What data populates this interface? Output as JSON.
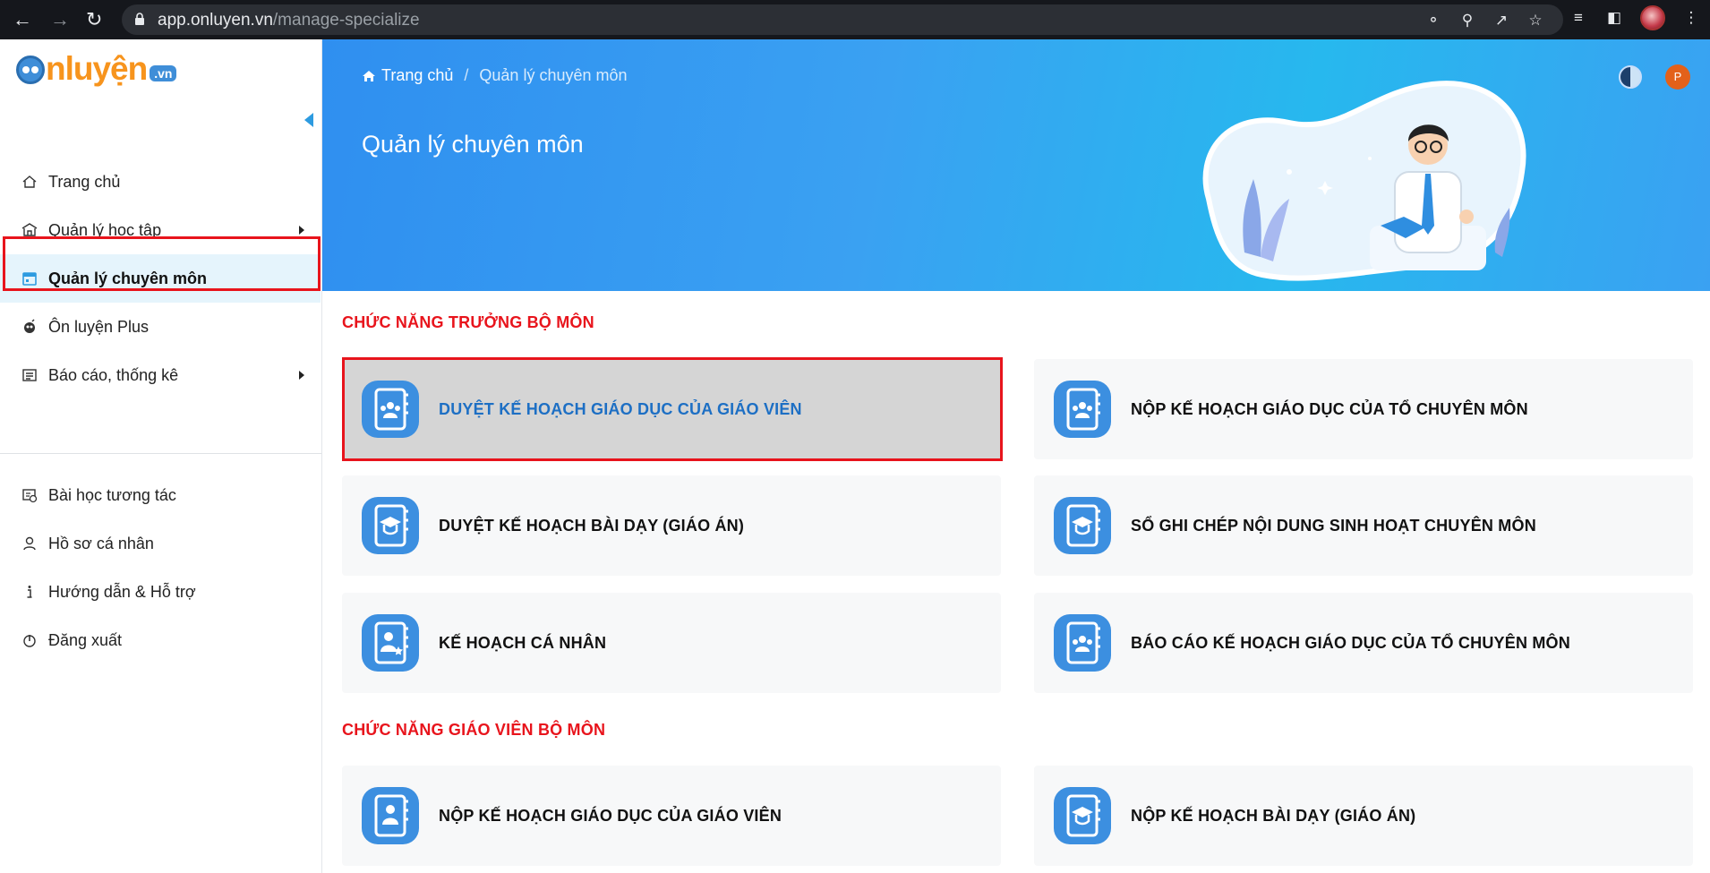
{
  "browser": {
    "url_host": "app.onluyen.vn",
    "url_path": "/manage-specialize",
    "nav_icons": [
      "back-icon",
      "forward-icon",
      "reload-icon"
    ],
    "url_icons": [
      "key-icon",
      "zoom-icon",
      "share-icon",
      "star-icon"
    ],
    "toolbar_icons": [
      "media-icon",
      "sidebar-icon",
      "profile-avatar"
    ]
  },
  "logo": {
    "text": "nluyện",
    "badge": ".vn"
  },
  "sidebar": {
    "items": [
      {
        "label": "Trang chủ",
        "icon": "home-icon"
      },
      {
        "label": "Quản lý học tập",
        "icon": "school-icon",
        "has_submenu": true
      },
      {
        "label": "Quản lý chuyên môn",
        "icon": "calendar-icon",
        "active": true
      },
      {
        "label": "Ôn luyện Plus",
        "icon": "plus-icon"
      },
      {
        "label": "Báo cáo, thống kê",
        "icon": "report-icon",
        "has_submenu": true
      }
    ],
    "items2": [
      {
        "label": "Bài học tương tác",
        "icon": "interactive-lesson-icon"
      },
      {
        "label": "Hồ sơ cá nhân",
        "icon": "user-icon"
      },
      {
        "label": "Hướng dẫn & Hỗ trợ",
        "icon": "info-icon"
      },
      {
        "label": "Đăng xuất",
        "icon": "power-icon"
      }
    ]
  },
  "banner": {
    "breadcrumb_home": "Trang chủ",
    "breadcrumb_sep": "/",
    "breadcrumb_current": "Quản lý chuyên môn",
    "title": "Quản lý chuyên môn",
    "user_initial": "P"
  },
  "sections": [
    {
      "title": "CHỨC NĂNG TRƯỞNG BỘ MÔN",
      "cards": [
        {
          "label": "DUYỆT KẾ HOẠCH GIÁO DỤC CỦA GIÁO VIÊN",
          "icon": "group-notebook-icon",
          "selected": true
        },
        {
          "label": "NỘP KẾ HOẠCH GIÁO DỤC CỦA TỔ CHUYÊN MÔN",
          "icon": "group-notebook-icon"
        },
        {
          "label": "DUYỆT KẾ HOẠCH BÀI DẠY (GIÁO ÁN)",
          "icon": "graduation-notebook-icon"
        },
        {
          "label": "SỔ GHI CHÉP NỘI DUNG SINH HOẠT CHUYÊN MÔN",
          "icon": "graduation-notebook-icon"
        },
        {
          "label": "KẾ HOẠCH CÁ NHÂN",
          "icon": "person-star-notebook-icon"
        },
        {
          "label": "BÁO CÁO KẾ HOẠCH GIÁO DỤC CỦA TỔ CHUYÊN MÔN",
          "icon": "group-notebook-icon"
        }
      ]
    },
    {
      "title": "CHỨC NĂNG GIÁO VIÊN BỘ MÔN",
      "cards": [
        {
          "label": "NỘP KẾ HOẠCH GIÁO DỤC CỦA GIÁO VIÊN",
          "icon": "person-notebook-icon"
        },
        {
          "label": "NỘP KẾ HOẠCH BÀI DẠY (GIÁO ÁN)",
          "icon": "graduation-notebook-icon"
        }
      ]
    }
  ],
  "colors": {
    "accent": "#2d9be0",
    "section_title": "#e8141c",
    "highlight_border": "#e8141c",
    "selected_text": "#1d6fc4",
    "logo_orange": "#f7941d"
  }
}
